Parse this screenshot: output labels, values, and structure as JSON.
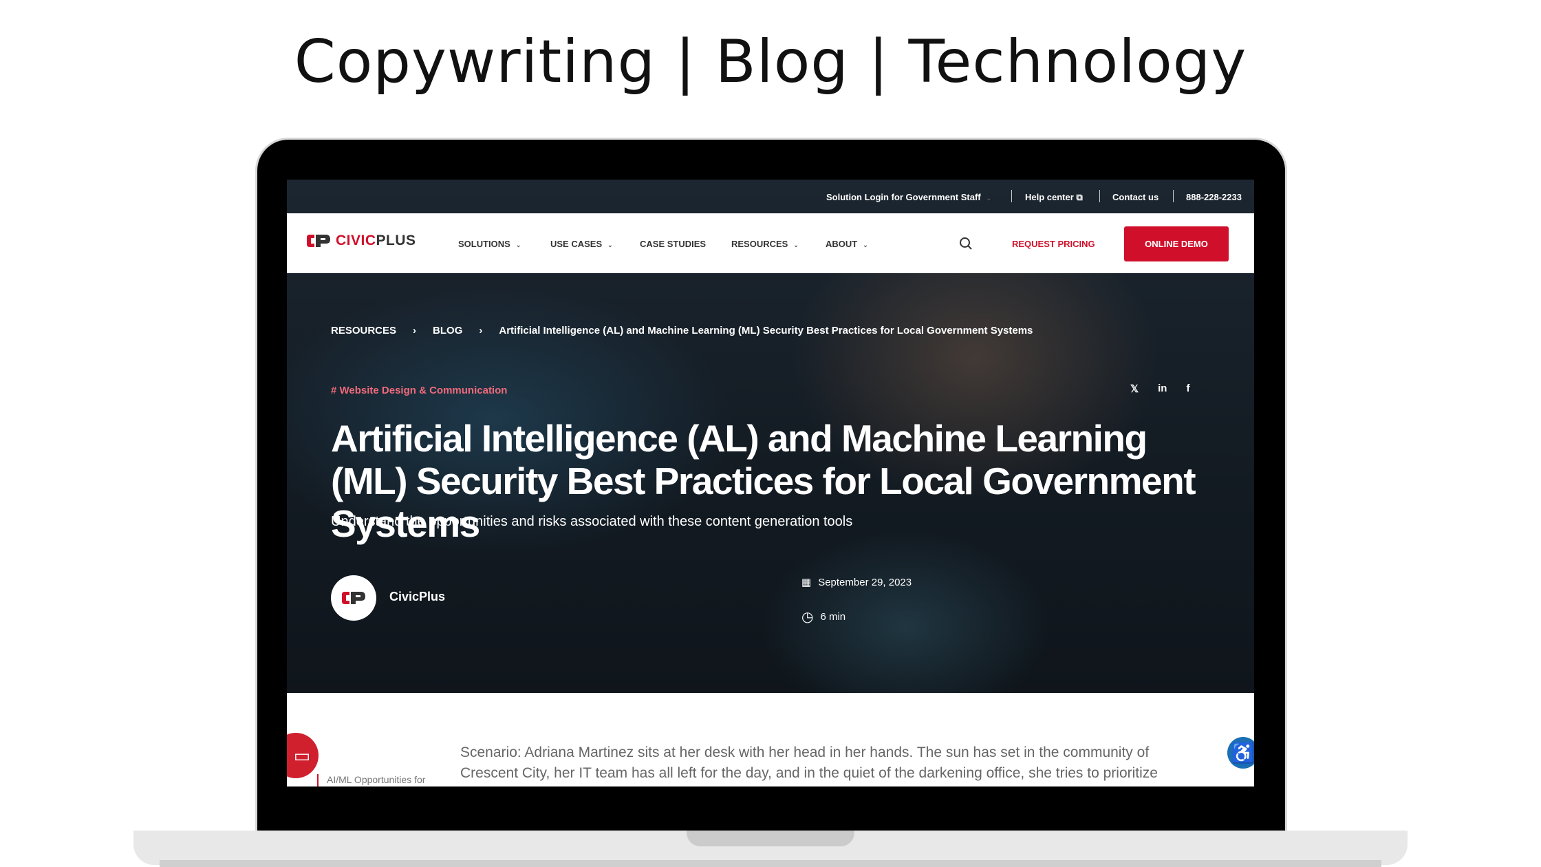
{
  "page_title": "Copywriting | Blog | Technology",
  "topbar": {
    "login": "Solution Login for Government Staff",
    "help": "Help center",
    "contact": "Contact us",
    "phone": "888-228-2233"
  },
  "nav": {
    "logo_a": "CIVIC",
    "logo_b": "PLUS",
    "items": [
      "SOLUTIONS",
      "USE CASES",
      "CASE STUDIES",
      "RESOURCES",
      "ABOUT"
    ],
    "request_pricing": "REQUEST PRICING",
    "online_demo": "ONLINE DEMO"
  },
  "breadcrumb": [
    "RESOURCES",
    "BLOG",
    "Artificial Intelligence (AL) and Machine Learning (ML) Security Best Practices for Local Government Systems"
  ],
  "article": {
    "tag": "# Website Design & Communication",
    "headline": "Artificial Intelligence (AL) and Machine Learning (ML) Security Best Practices for Local Government Systems",
    "subtitle": "Understand the opportunities and risks associated with these content generation tools",
    "author": "CivicPlus",
    "date": "September 29, 2023",
    "read_time": "6 min",
    "toc_item": "AI/ML Opportunities for",
    "body": "Scenario: Adriana Martinez sits at her desk with her head in her hands. The sun has set in the community of Crescent City, her IT team has all left for the day, and in the quiet of the darkening office, she tries to prioritize"
  },
  "colors": {
    "brand": "#d0102b",
    "accessibility": "#1a6fb5"
  }
}
